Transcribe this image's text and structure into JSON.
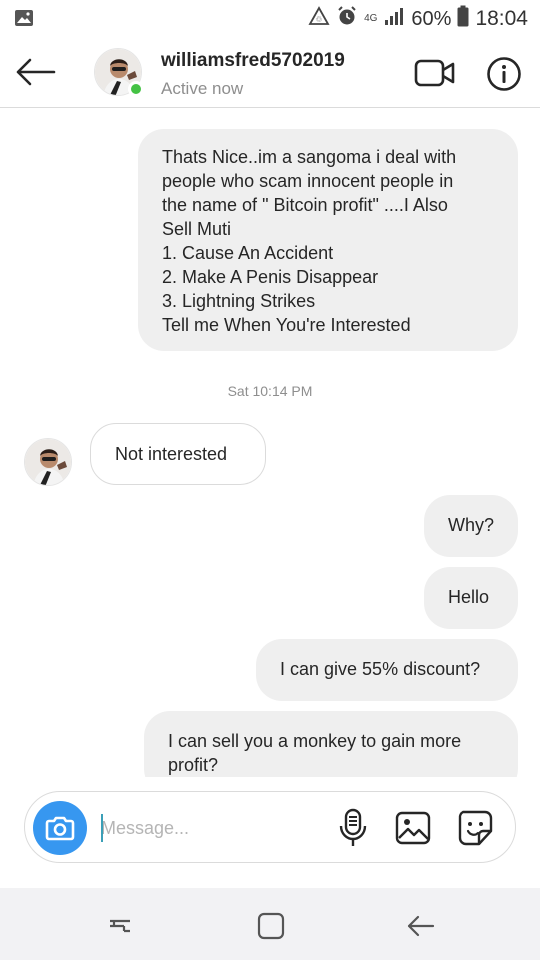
{
  "status_bar": {
    "network": "4G",
    "battery": "60%",
    "time": "18:04"
  },
  "header": {
    "username": "williamsfred5702019",
    "status": "Active now"
  },
  "messages": [
    {
      "id": "m1",
      "direction": "sent",
      "lines": [
        "Thats Nice..im a sangoma i deal with",
        "people who scam innocent people in",
        "the name of \" Bitcoin profit\" ....I Also",
        "Sell Muti",
        "1. Cause An Accident",
        "2. Make A Penis Disappear",
        "3. Lightning Strikes",
        "Tell me When You're Interested"
      ]
    },
    {
      "id": "m2",
      "direction": "received",
      "text": "Not interested"
    },
    {
      "id": "m3",
      "direction": "sent",
      "text": "Why?"
    },
    {
      "id": "m4",
      "direction": "sent",
      "text": "Hello"
    },
    {
      "id": "m5",
      "direction": "sent",
      "text": "I can give 55% discount?"
    },
    {
      "id": "m6",
      "direction": "sent",
      "lines": [
        "I can sell you a monkey to gain more",
        "profit?"
      ]
    }
  ],
  "timestamp": "Sat 10:14 PM",
  "composer": {
    "placeholder": "Message..."
  },
  "colors": {
    "accent": "#3797f0",
    "online": "#44c244",
    "bubble_sent": "#efefef",
    "border": "#dbdbdb"
  }
}
